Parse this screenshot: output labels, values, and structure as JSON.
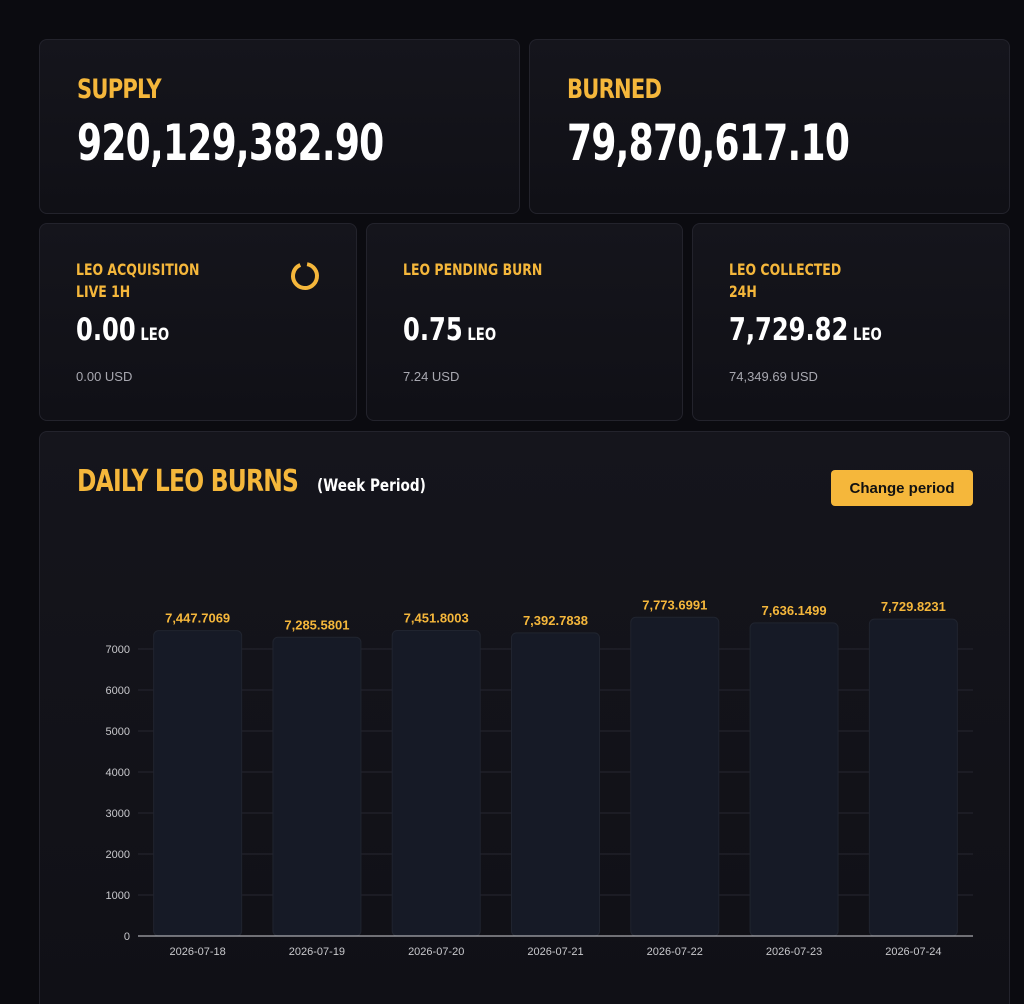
{
  "colors": {
    "accent": "#f5b73b",
    "bar_fill": "#161a26",
    "grid": "#262630",
    "axis_text": "#c8c8cc"
  },
  "supply": {
    "label": "SUPPLY",
    "value": "920,129,382.90"
  },
  "burned": {
    "label": "BURNED",
    "value": "79,870,617.10"
  },
  "acquisition": {
    "label_line1": "LEO ACQUISITION",
    "label_line2": "LIVE 1H",
    "value": "0.00",
    "unit": "LEO",
    "usd": "0.00 USD",
    "icon": "loading-spinner-icon"
  },
  "pending": {
    "label_line1": "LEO PENDING BURN",
    "value": "0.75",
    "unit": "LEO",
    "usd": "7.24 USD"
  },
  "collected": {
    "label_line1": "LEO COLLECTED",
    "label_line2": "24H",
    "value": "7,729.82",
    "unit": "LEO",
    "usd": "74,349.69 USD"
  },
  "daily_burns": {
    "title": "DAILY LEO BURNS",
    "subtitle": "(Week Period)",
    "button_label": "Change period"
  },
  "chart_data": {
    "type": "bar",
    "title": "DAILY LEO BURNS",
    "subtitle": "(Week Period)",
    "xlabel": "",
    "ylabel": "",
    "categories": [
      "2026-07-18",
      "2026-07-19",
      "2026-07-20",
      "2026-07-21",
      "2026-07-22",
      "2026-07-23",
      "2026-07-24"
    ],
    "values": [
      7447.7069,
      7285.5801,
      7451.8003,
      7392.7838,
      7773.6991,
      7636.1499,
      7729.8231
    ],
    "data_labels": [
      "7,447.7069",
      "7,285.5801",
      "7,451.8003",
      "7,392.7838",
      "7,773.6991",
      "7,636.1499",
      "7,729.8231"
    ],
    "y_ticks": [
      0,
      1000,
      2000,
      3000,
      4000,
      5000,
      6000,
      7000
    ],
    "ylim": [
      0,
      7000
    ],
    "grid": true,
    "legend": "none"
  }
}
